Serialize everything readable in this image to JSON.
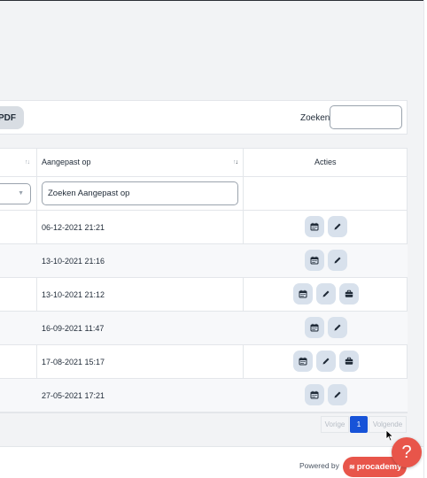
{
  "toolbar": {
    "pdf_label": "PDF",
    "search_label": "Zoeken:",
    "search_value": ""
  },
  "table": {
    "columns": [
      {
        "label": "",
        "sort": "unsorted"
      },
      {
        "label": "Aangepast op",
        "sort": "descending"
      },
      {
        "label": "Acties"
      }
    ],
    "filter_placeholder": "Zoeken Aangepast op",
    "rows": [
      {
        "modified": "06-12-2021 21:21",
        "actions": [
          "calendar-icon",
          "pencil-icon"
        ]
      },
      {
        "modified": "13-10-2021 21:16",
        "actions": [
          "calendar-icon",
          "pencil-icon"
        ]
      },
      {
        "modified": "13-10-2021 21:12",
        "actions": [
          "calendar-icon",
          "pencil-icon",
          "briefcase-icon"
        ]
      },
      {
        "modified": "16-09-2021 11:47",
        "actions": [
          "calendar-icon",
          "pencil-icon"
        ]
      },
      {
        "modified": "17-08-2021 15:17",
        "actions": [
          "calendar-icon",
          "pencil-icon",
          "briefcase-icon"
        ]
      },
      {
        "modified": "27-05-2021 17:21",
        "actions": [
          "calendar-icon",
          "pencil-icon"
        ]
      }
    ]
  },
  "pagination": {
    "prev": "Vorige",
    "current": "1",
    "next": "Volgende"
  },
  "footer": {
    "powered_by": "Powered by",
    "brand": "procademy"
  },
  "help": {
    "label": "?"
  },
  "colors": {
    "accent": "#1753d8",
    "brand": "#e8554a",
    "action_bg": "#d8e1ec"
  }
}
